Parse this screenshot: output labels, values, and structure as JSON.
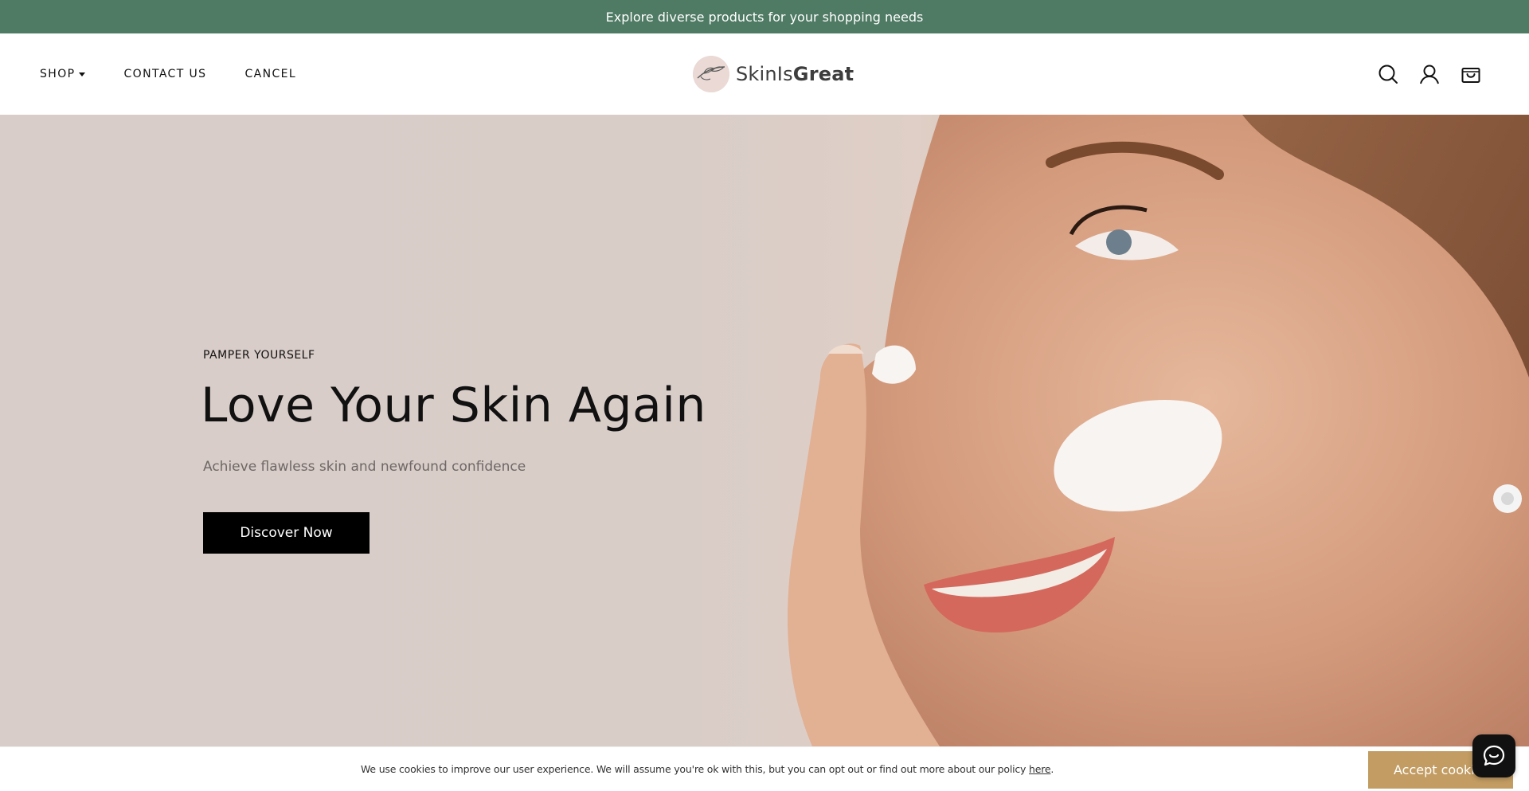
{
  "announcement": {
    "text": "Explore diverse products for your shopping needs"
  },
  "nav": {
    "shop": "SHOP",
    "contact": "CONTACT US",
    "cancel": "CANCEL"
  },
  "logo": {
    "text_regular": "SkinIs",
    "text_bold": "Great"
  },
  "header_icons": [
    "search-icon",
    "account-icon",
    "cart-icon"
  ],
  "hero": {
    "eyebrow": "PAMPER YOURSELF",
    "headline": "Love Your Skin Again",
    "subheadline": "Achieve flawless skin and newfound confidence",
    "cta": "Discover Now"
  },
  "cookie_bar": {
    "message": "We use cookies to improve our user experience. We will assume you're ok with this, but you can opt out or find out more about our policy",
    "link": "here",
    "period": ".",
    "accept": "Accept cookies"
  },
  "colors": {
    "announcement_bg": "#4f7a63",
    "cta_bg": "#000000",
    "accept_bg": "#c29c62",
    "chat_bg": "#111111"
  }
}
